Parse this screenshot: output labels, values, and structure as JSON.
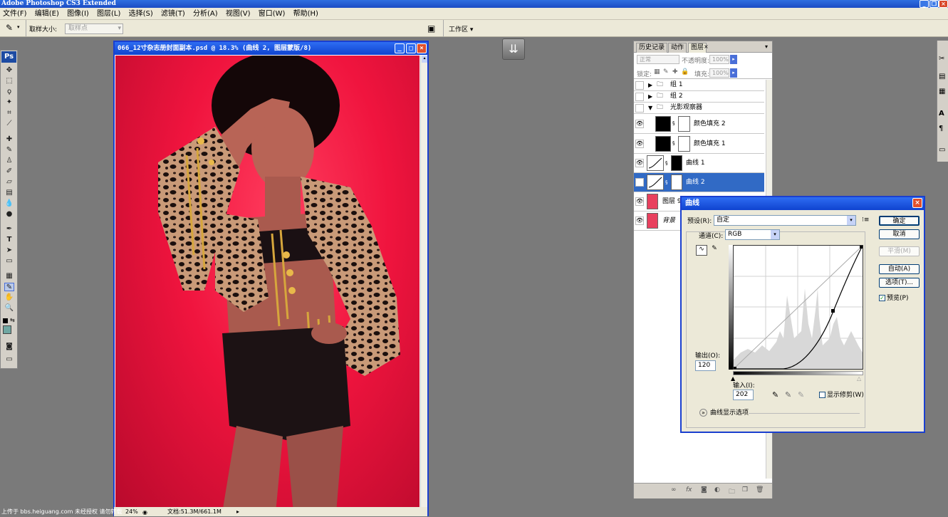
{
  "app": {
    "title": "Adobe Photoshop CS3 Extended"
  },
  "menu": [
    "文件(F)",
    "编辑(E)",
    "图像(I)",
    "图层(L)",
    "选择(S)",
    "滤镜(T)",
    "分析(A)",
    "视图(V)",
    "窗口(W)",
    "帮助(H)"
  ],
  "options": {
    "sample_size_label": "取样大小:",
    "sample_size_value": "取样点",
    "workspace_label": "工作区 ▾"
  },
  "toolbox": {
    "logo": "Ps"
  },
  "document": {
    "title": "066_12寸杂志册封面副本.psd @ 18.3% (曲线 2, 图层蒙版/8)",
    "zoom": "24%",
    "doc_info": "文档:51.3M/661.1M"
  },
  "panel": {
    "tabs": [
      "历史记录",
      "动作",
      "图层"
    ],
    "blend_mode": "正常",
    "opacity_label": "不透明度:",
    "opacity_value": "100%",
    "lock_label": "锁定:",
    "fill_label": "填充:",
    "fill_value": "100%",
    "layers": [
      {
        "name": "组 1"
      },
      {
        "name": "组 2"
      },
      {
        "name": "光影观察器"
      },
      {
        "name": "颜色填充 2"
      },
      {
        "name": "颜色填充 1"
      },
      {
        "name": "曲线 1"
      },
      {
        "name": "曲线 2"
      },
      {
        "name": "图层 9"
      },
      {
        "name": "背景"
      }
    ]
  },
  "curves_dialog": {
    "title": "曲线",
    "preset_label": "预设(R):",
    "preset_value": "自定",
    "channel_label": "通道(C):",
    "channel_value": "RGB",
    "buttons": {
      "ok": "确定",
      "cancel": "取消",
      "smooth": "平滑(M)",
      "auto": "自动(A)",
      "options": "选项(T)..."
    },
    "preview_label": "预览(P)",
    "preview_checked": true,
    "output_label": "输出(O):",
    "output_value": "120",
    "input_label": "输入(I):",
    "input_value": "202",
    "show_clipping_label": "显示修剪(W)",
    "show_clipping_checked": false,
    "display_options_label": "曲线显示选项"
  },
  "watermark": {
    "text": "上传于 bbs.heiguang.com  未经授权  请勿转载"
  },
  "colors": {
    "title_blue": "#1c4cc4",
    "selected_layer": "#316ac5",
    "canvas_red": "#f0143e"
  }
}
